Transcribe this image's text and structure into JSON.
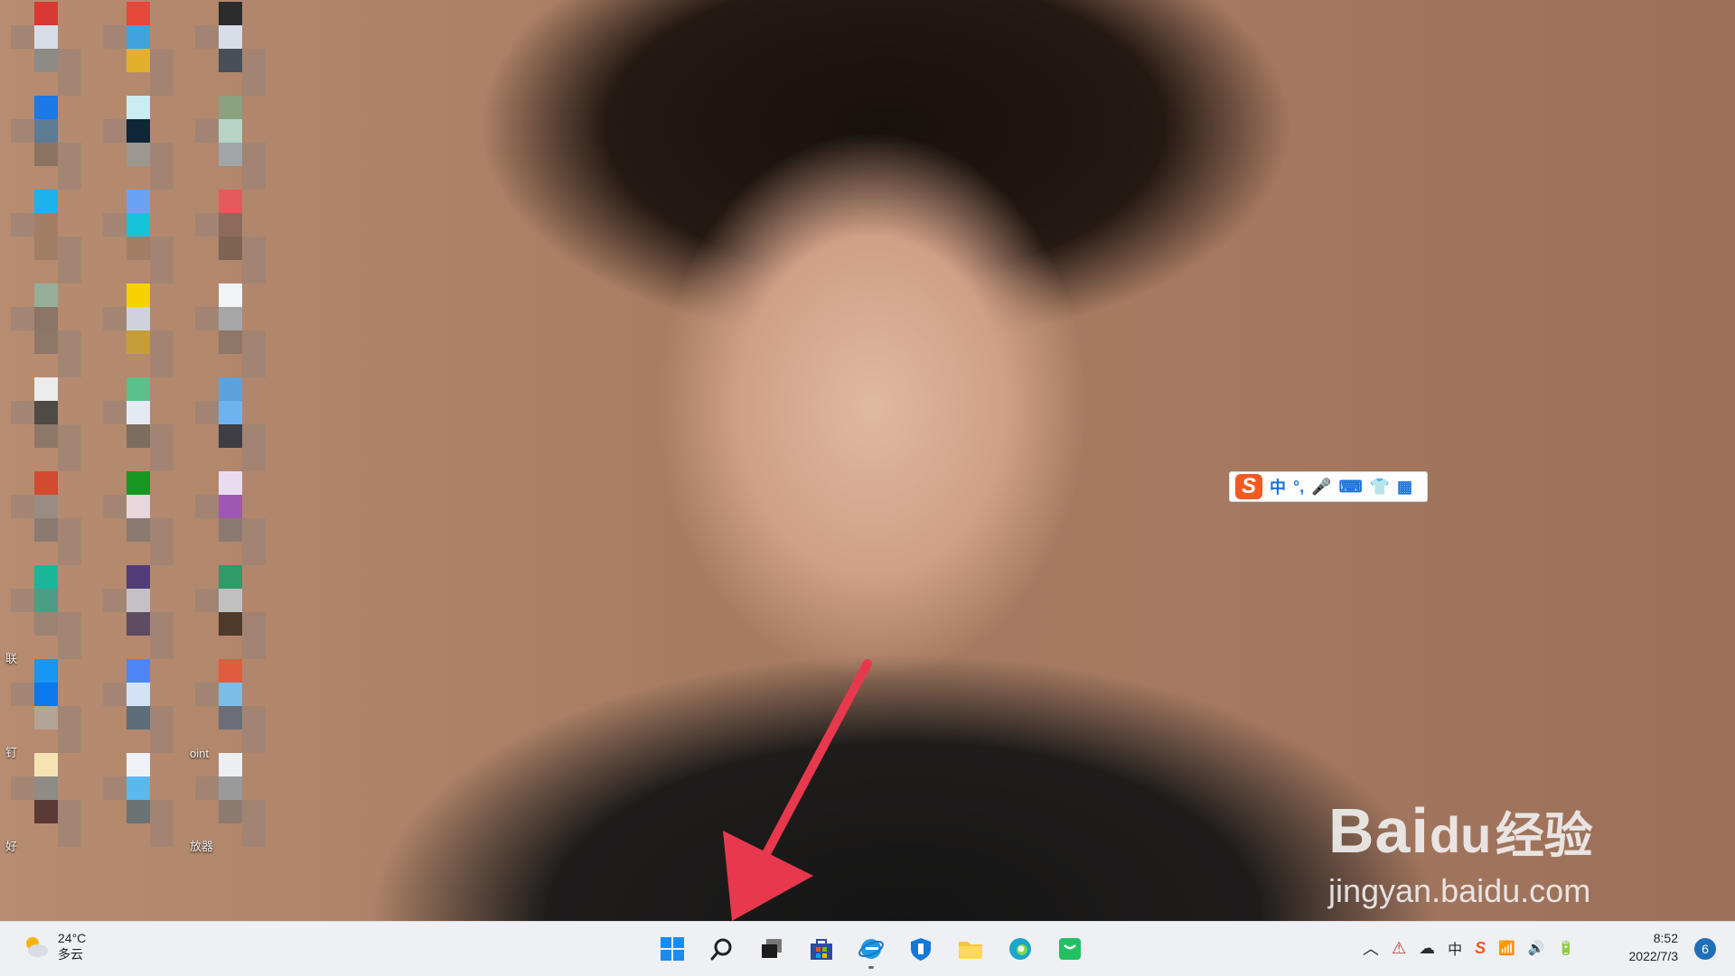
{
  "desktop": {
    "icons": [
      {
        "label": "",
        "colors": [
          "#d83a33",
          "#d7dde7",
          "#8e8a86"
        ]
      },
      {
        "label": "",
        "colors": [
          "#e5473b",
          "#3fa3e0",
          "#e2b12b"
        ]
      },
      {
        "label": "",
        "colors": [
          "#2c2c2c",
          "#d8dce6",
          "#4a4e55"
        ]
      },
      {
        "label": "",
        "colors": [
          "#1b7ae8",
          "#5e7b94",
          "#8b7460"
        ]
      },
      {
        "label": "",
        "colors": [
          "#ccebf5",
          "#0e2638",
          "#9d988f"
        ]
      },
      {
        "label": "",
        "colors": [
          "#8aa27f",
          "#b6d3c5",
          "#a2a4a8"
        ]
      },
      {
        "label": "",
        "colors": [
          "#1bb2ee",
          "#a37e66",
          "#a37e66"
        ]
      },
      {
        "label": "",
        "colors": [
          "#6aa3f2",
          "#15c3dd",
          "#a37e66"
        ]
      },
      {
        "label": "",
        "colors": [
          "#e4595a",
          "#8c6b5b",
          "#7f6454"
        ]
      },
      {
        "label": "",
        "colors": [
          "#97ae9a",
          "#8a7567",
          "#8c7769"
        ]
      },
      {
        "label": "",
        "colors": [
          "#f7d100",
          "#cfd2dd",
          "#c79d3a"
        ]
      },
      {
        "label": "",
        "colors": [
          "#f2f3f5",
          "#a6a6a6",
          "#8f7666"
        ]
      },
      {
        "label": "",
        "colors": [
          "#ececec",
          "#4f4a43",
          "#8d7769"
        ]
      },
      {
        "label": "",
        "colors": [
          "#5bc08a",
          "#e4eaf1",
          "#7d6d5e"
        ]
      },
      {
        "label": "",
        "colors": [
          "#5ea2db",
          "#6db3ef",
          "#3f3e45"
        ]
      },
      {
        "label": "",
        "colors": [
          "#d24a30",
          "#9a8c83",
          "#8c7a70"
        ]
      },
      {
        "label": "",
        "colors": [
          "#179820",
          "#e8d6dc",
          "#8c7a70"
        ]
      },
      {
        "label": "",
        "colors": [
          "#eadcef",
          "#a057b4",
          "#8c7a70"
        ]
      },
      {
        "label": "联",
        "colors": [
          "#19b79a",
          "#4c9d84",
          "#9b8374"
        ]
      },
      {
        "label": "",
        "colors": [
          "#523c77",
          "#c4c0c6",
          "#5f4c60"
        ]
      },
      {
        "label": "",
        "colors": [
          "#2f9b66",
          "#c1c0c0",
          "#4f3a2b"
        ]
      },
      {
        "label": "钉",
        "colors": [
          "#1697f2",
          "#0b79ee",
          "#b2a496"
        ]
      },
      {
        "label": "",
        "colors": [
          "#4c86f7",
          "#d2e2f7",
          "#5d6d79"
        ]
      },
      {
        "label": "oint",
        "colors": [
          "#e25b3c",
          "#7cbde6",
          "#6b6e75"
        ]
      },
      {
        "label": "好",
        "colors": [
          "#f6e3b4",
          "#8f8b86",
          "#5a3a36"
        ]
      },
      {
        "label": "",
        "colors": [
          "#eef2f7",
          "#5ab8ef",
          "#6c7374"
        ]
      },
      {
        "label": "放器",
        "colors": [
          "#eceef2",
          "#9a9a9a",
          "#8d7b70"
        ]
      }
    ]
  },
  "ime_bar": {
    "logo": "S",
    "items": [
      {
        "label": "中",
        "icon": "chinese-mode"
      },
      {
        "label": "°,",
        "icon": "punctuation"
      },
      {
        "label": "🎤",
        "icon": "microphone-icon"
      },
      {
        "label": "⌨",
        "icon": "keyboard-icon"
      },
      {
        "label": "👕",
        "icon": "skin-icon"
      },
      {
        "label": "▦",
        "icon": "toolbox-icon"
      }
    ]
  },
  "watermark": {
    "brand": "Bai",
    "brand_suffix": "du",
    "cn": "经验",
    "url": "jingyan.baidu.com"
  },
  "taskbar": {
    "weather": {
      "temp": "24°C",
      "desc": "多云"
    },
    "apps": [
      {
        "name": "start-button",
        "icon": "windows-logo-icon"
      },
      {
        "name": "search-button",
        "icon": "search-icon"
      },
      {
        "name": "task-view-button",
        "icon": "task-view-icon"
      },
      {
        "name": "store-button",
        "icon": "store-icon"
      },
      {
        "name": "ie-button",
        "icon": "internet-explorer-icon"
      },
      {
        "name": "defender-button",
        "icon": "shield-icon"
      },
      {
        "name": "file-explorer-button",
        "icon": "folder-icon"
      },
      {
        "name": "edge-button",
        "icon": "edge-icon"
      },
      {
        "name": "green-app-button",
        "icon": "chat-icon"
      }
    ],
    "tray": [
      {
        "name": "chevron-up-icon",
        "glyph": "︿"
      },
      {
        "name": "network-alert-icon",
        "glyph": "⚠"
      },
      {
        "name": "cloud-icon",
        "glyph": "☁"
      },
      {
        "name": "ime-indicator",
        "glyph": "中"
      },
      {
        "name": "sogou-tray-icon",
        "glyph": "S"
      },
      {
        "name": "wifi-icon",
        "glyph": "📶"
      },
      {
        "name": "volume-icon",
        "glyph": "🔊"
      },
      {
        "name": "battery-icon",
        "glyph": "🔋"
      }
    ],
    "clock": {
      "time": "8:52",
      "date": "2022/7/3"
    },
    "notifications": "6"
  }
}
